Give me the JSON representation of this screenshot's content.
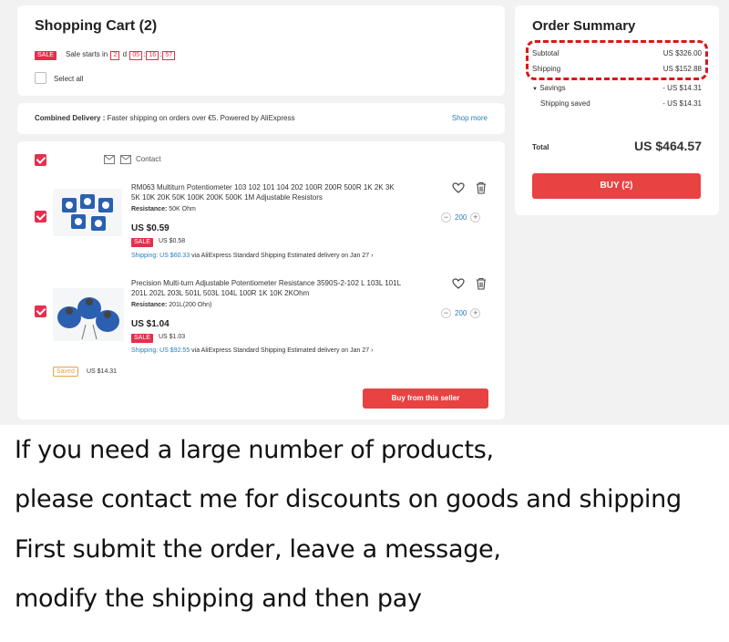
{
  "cart": {
    "title": "Shopping Cart (2)",
    "sale_badge": "SALE",
    "sale_starts_text": "Sale starts in",
    "countdown": {
      "days": "2",
      "d_label": "d",
      "hours": "05",
      "minutes": "16",
      "seconds": "57"
    },
    "select_all": "Select all"
  },
  "delivery": {
    "label": "Combined Delivery :",
    "text": "Faster shipping on orders over €5. Powered by AliExpress",
    "link": "Shop more"
  },
  "store": {
    "contact": "Contact"
  },
  "items": [
    {
      "title": "RM063 Multiturn Potentiometer 103 102 101 104 202 100R 200R 500R 1K 2K 3K 5K 10K 20K 50K 100K 200K 500K 1M Adjustable Resistors",
      "attr_label": "Resistance:",
      "attr_value": "50K Ohm",
      "price": "US $0.59",
      "sale_badge": "SALE",
      "sale_price": "US $0.58",
      "shipping_label": "Shipping: US $60.33",
      "shipping_via": "via AliExpress Standard Shipping",
      "delivery": "Estimated delivery on Jan 27",
      "qty": "200"
    },
    {
      "title": "Precision Multi-turn Adjustable Potentiometer Resistance 3590S-2-102 L 103L 101L 201L 202L 203L 501L 503L 104L 100R 1K 10K 2KOhm",
      "attr_label": "Resistance:",
      "attr_value": "201L(200 Ohn)",
      "price": "US $1.04",
      "sale_badge": "SALE",
      "sale_price": "US $1.03",
      "shipping_label": "Shipping: US $92.55",
      "shipping_via": "via AliExpress Standard Shipping",
      "delivery": "Estimated delivery on Jan 27",
      "qty": "200"
    }
  ],
  "saved": {
    "badge": "Saved",
    "amount": "US $14.31"
  },
  "buy_seller": "Buy from this seller",
  "summary": {
    "title": "Order Summary",
    "subtotal_label": "Subtotal",
    "subtotal_value": "US $326.00",
    "shipping_label": "Shipping",
    "shipping_value": "US $152.88",
    "savings_label": "Savings",
    "savings_value": "- US $14.31",
    "shipping_saved_label": "Shipping saved",
    "shipping_saved_value": "- US $14.31",
    "total_label": "Total",
    "total_value": "US $464.57",
    "buy_button": "BUY (2)"
  },
  "message": {
    "line1": "If you need a large number of products,",
    "line2": "please contact me for discounts on goods and shipping",
    "line3": "First submit the order, leave a message,",
    "line4": "modify the shipping and then pay"
  },
  "colors": {
    "accent": "#e84242",
    "sale": "#e62e4d",
    "link": "#2a7fb8",
    "annotation": "#d81818"
  }
}
